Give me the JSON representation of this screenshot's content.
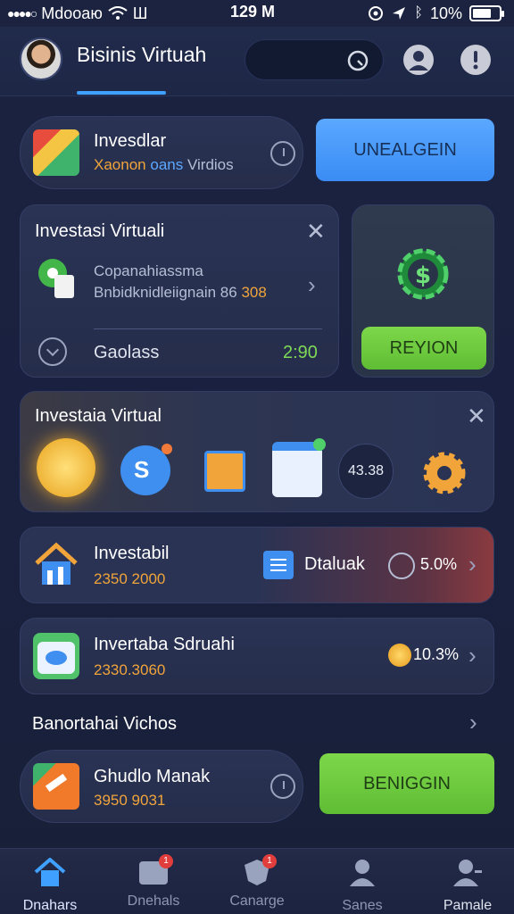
{
  "status_bar": {
    "carrier": "Mdoоаю",
    "wifi_label": "Ш",
    "time": "129 M",
    "battery_percent_text": "10%",
    "battery_level": 0.7
  },
  "header": {
    "title": "Bisinis Virtuah"
  },
  "card1": {
    "title": "Invesdlar",
    "sub_orange": "Xaonon",
    "sub_blue": "oans",
    "sub_gray": "Virdios",
    "button": "UNEALGEIN"
  },
  "card2": {
    "title": "Investasi Virtuali",
    "line1": "Copanahiassma",
    "line2_gray": "Bnbidknidleiignain",
    "line2_num": "86",
    "line2_orange": "308",
    "row_label": "Gaolass",
    "row_value": "2:90"
  },
  "card2_side": {
    "button": "REYION"
  },
  "card3": {
    "title": "Investaia Virtual",
    "s_label": "S",
    "value": "43.38"
  },
  "row1": {
    "title": "Investabil",
    "amount": "2350 2000",
    "tag": "Dtaluak",
    "percent": "5.0%"
  },
  "row2": {
    "title": "Invertaba Sdruahi",
    "amount": "2330.3060",
    "percent": "10.3%"
  },
  "section": {
    "title": "Banortahai Vichos"
  },
  "row3": {
    "title": "Ghudlo Manak",
    "amount": "3950 9031",
    "button": "BENIGGIN"
  },
  "nav": {
    "items": [
      {
        "label": "Dnahars",
        "icon": "home-icon",
        "active": true
      },
      {
        "label": "Dnehals",
        "icon": "wallet-icon",
        "badge": "1"
      },
      {
        "label": "Canarge",
        "icon": "shield-icon",
        "badge": "1"
      },
      {
        "label": "Sanes",
        "icon": "user-icon"
      },
      {
        "label": "Pamale",
        "icon": "profile-icon"
      }
    ]
  },
  "colors": {
    "accent_blue": "#3fa0ff",
    "accent_green": "#6cc93f",
    "accent_orange": "#f0a43a",
    "background": "#1b2340"
  }
}
